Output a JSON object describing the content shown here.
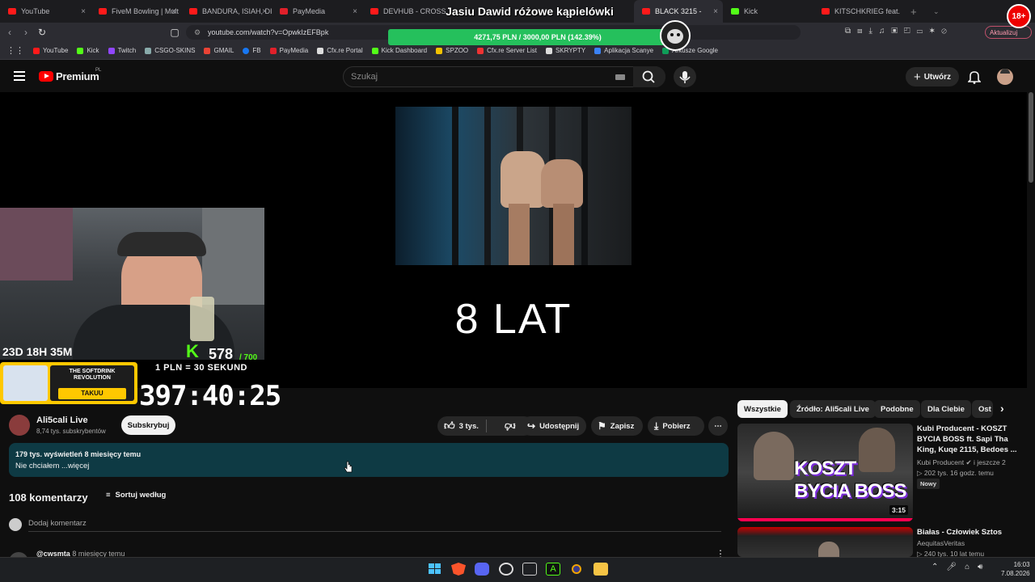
{
  "tabs": [
    {
      "label": "YouTube",
      "favicon": "youtube"
    },
    {
      "label": "FiveM Bowling | Mult",
      "favicon": "youtube"
    },
    {
      "label": "BANDURA, ISIAH, DIV",
      "favicon": "youtube"
    },
    {
      "label": "PayMedia",
      "favicon": "paymedia"
    },
    {
      "label": "DEVHUB - CROSS",
      "favicon": "youtube"
    },
    {
      "label": "BLACK 3215 -",
      "favicon": "youtube"
    },
    {
      "label": "Kick",
      "favicon": "kick"
    },
    {
      "label": "KITSCHKRIEG feat. BL",
      "favicon": "youtube"
    }
  ],
  "address_bar": {
    "url": "youtube.com/watch?v=OpwkIzEFBpk",
    "update_label": "Aktualizuj"
  },
  "bookmarks": [
    "YouTube",
    "Kick",
    "Twitch",
    "CSGO-SKINS",
    "GMAIL",
    "FB",
    "PayMedia",
    "Cfx.re Portal",
    "Kick Dashboard",
    "SPZOO",
    "Cfx.re Server List",
    "SKRYPTY",
    "Aplikacja Scanye",
    "Arkusze Google"
  ],
  "yt": {
    "brand": "Premium",
    "brand_region": "PL",
    "search_placeholder": "Szukaj",
    "create_label": "Utwórz"
  },
  "overlay": {
    "donation_title": "Jasiu Dawid różowe kąpielówki",
    "donation_progress": "4271,75 PLN / 3000,00 PLN (142.39%)",
    "donation_fraction": 1.4239,
    "age_badge": "18+",
    "timer_small": "23D 18H 35M",
    "kick_count": "578",
    "kick_goal": "/ 700",
    "rate": "1 PLN = 30 SEKUND",
    "big_timer": "397:40:25",
    "ad_line1": "THE SOFTDRINK",
    "ad_line2": "REVOLUTION",
    "ad_button": "TAKUU"
  },
  "video": {
    "caption": "8 LAT"
  },
  "channel": {
    "name": "Ali5cali Live",
    "subscribers": "8,74 tys. subskrybentów",
    "subscribe_label": "Subskrybuj"
  },
  "actions": {
    "likes": "3 tys.",
    "share": "Udostępnij",
    "save": "Zapisz",
    "download": "Pobierz"
  },
  "description": {
    "stats": "179 tys. wyświetleń  8 miesięcy temu",
    "text": "Nie chciałem ...więcej"
  },
  "comments": {
    "count": "108 komentarzy",
    "sort_label": "Sortuj według",
    "add_placeholder": "Dodaj komentarz",
    "first_author": "@cwsmta",
    "first_time": "8 miesięcy temu"
  },
  "chips": [
    "Wszystkie",
    "Źródło: Ali5cali Live",
    "Podobne",
    "Dla Ciebie",
    "Ost"
  ],
  "recommendations": [
    {
      "title": "Kubi Producent - KOSZT BYCIA BOSS ft. Sapi Tha King, Kuqe 2115, Bedoes ...",
      "channel": "Kubi Producent",
      "channel_extra": "i jeszcze 2",
      "meta": "202 tys.   16 godz. temu",
      "badge": "Nowy",
      "duration": "3:15",
      "thumb_text": "KOSZT BYCIA BOSS"
    },
    {
      "title": "Białas - Człowiek Sztos",
      "channel": "AequitasVeritas",
      "meta": "240 tys.   10 lat temu"
    }
  ],
  "taskbar": {
    "time": "16:03",
    "date": "7.08.2026"
  }
}
